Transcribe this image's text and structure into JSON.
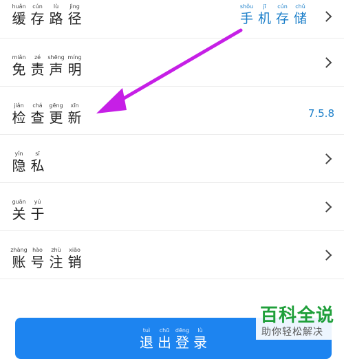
{
  "settings": {
    "rows": [
      {
        "id": "cache-path",
        "label": [
          {
            "py": "huǎn",
            "hz": "缓"
          },
          {
            "py": "cún",
            "hz": "存"
          },
          {
            "py": "lù",
            "hz": "路"
          },
          {
            "py": "jìng",
            "hz": "径"
          }
        ],
        "value": [
          {
            "py": "shǒu",
            "hz": "手"
          },
          {
            "py": "jī",
            "hz": "机"
          },
          {
            "py": "cún",
            "hz": "存"
          },
          {
            "py": "chǔ",
            "hz": "储"
          }
        ]
      },
      {
        "id": "disclaimer",
        "label": [
          {
            "py": "miǎn",
            "hz": "免"
          },
          {
            "py": "zé",
            "hz": "责"
          },
          {
            "py": "shēng",
            "hz": "声"
          },
          {
            "py": "míng",
            "hz": "明"
          }
        ]
      },
      {
        "id": "check-update",
        "label": [
          {
            "py": "jiǎn",
            "hz": "检"
          },
          {
            "py": "chá",
            "hz": "查"
          },
          {
            "py": "gēng",
            "hz": "更"
          },
          {
            "py": "xīn",
            "hz": "新"
          }
        ],
        "version": "7.5.8"
      },
      {
        "id": "privacy",
        "label": [
          {
            "py": "yǐn",
            "hz": "隐"
          },
          {
            "py": "sī",
            "hz": "私"
          }
        ]
      },
      {
        "id": "about",
        "label": [
          {
            "py": "guān",
            "hz": "关"
          },
          {
            "py": "yú",
            "hz": "于"
          }
        ]
      },
      {
        "id": "account-cancel",
        "label": [
          {
            "py": "zhàng",
            "hz": "账"
          },
          {
            "py": "hào",
            "hz": "号"
          },
          {
            "py": "zhù",
            "hz": "注"
          },
          {
            "py": "xiāo",
            "hz": "销"
          }
        ]
      }
    ]
  },
  "logout": [
    {
      "py": "tuì",
      "hz": "退"
    },
    {
      "py": "chū",
      "hz": "出"
    },
    {
      "py": "dēng",
      "hz": "登"
    },
    {
      "py": "lù",
      "hz": "录"
    }
  ],
  "watermark": {
    "main": "百科全说",
    "sub": "助你轻松解决"
  },
  "colors": {
    "accent": "#1a7ec9",
    "button": "#1d84f0",
    "arrow": "#c61fe6",
    "watermark": "#1f9f3a"
  },
  "icons": {
    "row_chevron": "chevron-right-icon",
    "annotation": "pointer-arrow-icon"
  }
}
